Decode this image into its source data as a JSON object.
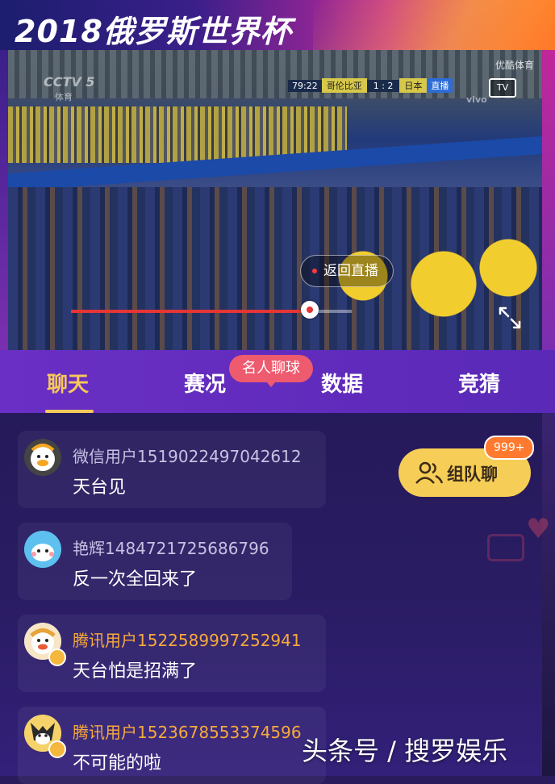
{
  "banner": {
    "title": "2018俄罗斯世界杯"
  },
  "player": {
    "broadcaster": "CCTV 5",
    "broadcaster_sub": "体育",
    "partner": "优酷体育",
    "scoreboard": {
      "time": "79:22",
      "team1": "哥伦比亚",
      "score": "1 : 2",
      "team2": "日本",
      "status": "直播"
    },
    "tv_icon_label": "TV",
    "sponsor": "vivo",
    "back_live_label": "返回直播",
    "progress_fraction": 0.85
  },
  "tabs": [
    {
      "label": "聊天",
      "active": true
    },
    {
      "label": "赛况",
      "active": false
    },
    {
      "label": "数据",
      "active": false
    },
    {
      "label": "竞猜",
      "active": false
    }
  ],
  "celebrity_bubble": "名人聊球",
  "group_chat": {
    "label": "组队聊",
    "badge": "999+"
  },
  "messages": [
    {
      "user": "微信用户1519022497042612",
      "text": "天台见",
      "name_color": "gray",
      "avatar": "white-duck"
    },
    {
      "user": "艳辉1484721725686796",
      "text": "反一次全回来了",
      "name_color": "gray",
      "avatar": "blue-bear"
    },
    {
      "user": "腾讯用户1522589997252941",
      "text": "天台怕是招满了",
      "name_color": "orange",
      "avatar": "white-duck-medal"
    },
    {
      "user": "腾讯用户1523678553374596",
      "text": "不可能的啦",
      "name_color": "orange",
      "avatar": "yellow-fox-medal"
    }
  ],
  "watermark": "头条号 / 搜罗娱乐",
  "colors": {
    "accent_gold": "#f6c85a",
    "tab_bar": "#6a2fc4",
    "chat_bg": "#2a1c63",
    "badge_orange": "#ff7a2f",
    "progress_red": "#e53535"
  }
}
